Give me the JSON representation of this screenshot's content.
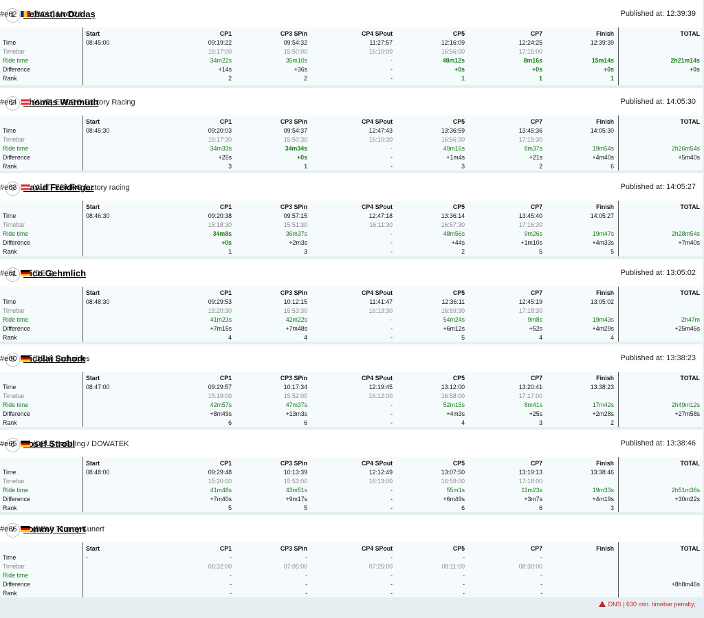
{
  "labels": {
    "time": "Time",
    "timebar": "Timebar",
    "ride_time": "Ride time",
    "difference": "Difference",
    "rank": "Rank",
    "published_prefix": "Published at:"
  },
  "columns": [
    "Start",
    "CP1",
    "CP3 SPin",
    "CP4 SPout",
    "CP5",
    "CP7",
    "Finish",
    "TOTAL"
  ],
  "riders": [
    {
      "pos": "1",
      "name": "Sebastian Dudaș",
      "bib": "#e62",
      "country": "(ROU) Moto24",
      "flag": "ROU",
      "published": "12:39:39",
      "start": "08:45:00",
      "time": [
        "09:19:22",
        "09:54:32",
        "11:27:57",
        "12:16:09",
        "12:24:25",
        "12:39:39",
        ""
      ],
      "timebar": [
        "15:17:00",
        "15:50:00",
        "16:10:00",
        "16:56:00",
        "17:15:00",
        "",
        ""
      ],
      "ride": [
        "34m22s",
        "35m10s",
        "-",
        "48m12s",
        "8m16s",
        "15m14s",
        "2h21m14s"
      ],
      "diff": [
        "+14s",
        "+36s",
        "-",
        "+0s",
        "+0s",
        "+0s",
        "+0s"
      ],
      "rank": [
        "2",
        "2",
        "-",
        "1",
        "1",
        "1",
        ""
      ],
      "best": [
        false,
        false,
        false,
        true,
        true,
        true,
        true
      ],
      "note": ""
    },
    {
      "pos": "2",
      "name": "Thomas Warmuth",
      "bib": "#e64",
      "country": "(AUT) EDURO Factory Racing",
      "flag": "AUT",
      "published": "14:05:30",
      "start": "08:45:30",
      "time": [
        "09:20:03",
        "09:54:37",
        "12:47:43",
        "13:36:59",
        "13:45:36",
        "14:05:30",
        ""
      ],
      "timebar": [
        "15:17:30",
        "15:50:30",
        "16:10:30",
        "16:56:30",
        "17:15:30",
        "",
        ""
      ],
      "ride": [
        "34m33s",
        "34m34s",
        "-",
        "49m16s",
        "8m37s",
        "19m54s",
        "2h26m54s"
      ],
      "diff": [
        "+25s",
        "+0s",
        "-",
        "+1m4s",
        "+21s",
        "+4m40s",
        "+5m40s"
      ],
      "rank": [
        "3",
        "1",
        "-",
        "3",
        "2",
        "6",
        ""
      ],
      "best": [
        false,
        true,
        false,
        false,
        false,
        false,
        false
      ],
      "note": ""
    },
    {
      "pos": "3",
      "name": "David Freidinger",
      "bib": "#e63",
      "country": "(AUT) EDURO factory racing",
      "flag": "AUT",
      "published": "14:05:27",
      "start": "08:46:30",
      "time": [
        "09:20:38",
        "09:57:15",
        "12:47:18",
        "13:36:14",
        "13:45:40",
        "14:05:27",
        ""
      ],
      "timebar": [
        "15:18:30",
        "15:51:30",
        "16:11:30",
        "16:57:30",
        "17:16:30",
        "",
        ""
      ],
      "ride": [
        "34m8s",
        "36m37s",
        "-",
        "48m56s",
        "9m26s",
        "19m47s",
        "2h28m54s"
      ],
      "diff": [
        "+0s",
        "+2m3s",
        "-",
        "+44s",
        "+1m10s",
        "+4m33s",
        "+7m40s"
      ],
      "rank": [
        "1",
        "3",
        "-",
        "2",
        "5",
        "5",
        ""
      ],
      "best": [
        true,
        false,
        false,
        false,
        false,
        false,
        false
      ],
      "note": ""
    },
    {
      "pos": "4",
      "name": "Rico Gehmlich",
      "bib": "#e61",
      "country": "(DEU)",
      "flag": "DEU",
      "published": "13:05:02",
      "start": "08:48:30",
      "time": [
        "09:29:53",
        "10:12:15",
        "11:41:47",
        "12:36:11",
        "12:45:19",
        "13:05:02",
        ""
      ],
      "timebar": [
        "15:20:30",
        "15:53:30",
        "16:13:30",
        "16:59:30",
        "17:18:30",
        "",
        ""
      ],
      "ride": [
        "41m23s",
        "42m22s",
        "-",
        "54m24s",
        "9m8s",
        "19m43s",
        "2h47m"
      ],
      "diff": [
        "+7m15s",
        "+7m48s",
        "-",
        "+6m12s",
        "+52s",
        "+4m29s",
        "+25m46s"
      ],
      "rank": [
        "4",
        "4",
        "-",
        "5",
        "4",
        "4",
        ""
      ],
      "best": [
        false,
        false,
        false,
        false,
        false,
        false,
        false
      ],
      "note": ""
    },
    {
      "pos": "5",
      "name": "Nicolai Schork",
      "bib": "#e60",
      "country": "(DEU) Endurides",
      "flag": "DEU",
      "published": "13:38:23",
      "start": "08:47:00",
      "time": [
        "09:29:57",
        "10:17:34",
        "12:19:45",
        "13:12:00",
        "13:20:41",
        "13:38:23",
        ""
      ],
      "timebar": [
        "15:19:00",
        "15:52:00",
        "16:12:00",
        "16:58:00",
        "17:17:00",
        "",
        ""
      ],
      "ride": [
        "42m57s",
        "47m37s",
        "-",
        "52m15s",
        "8m41s",
        "17m42s",
        "2h49m12s"
      ],
      "diff": [
        "+8m49s",
        "+13m3s",
        "-",
        "+4m3s",
        "+25s",
        "+2m28s",
        "+27m58s"
      ],
      "rank": [
        "6",
        "6",
        "-",
        "4",
        "3",
        "2",
        ""
      ],
      "best": [
        false,
        false,
        false,
        false,
        false,
        false,
        false
      ],
      "note": ""
    },
    {
      "pos": "6",
      "name": "Josef Strobl",
      "bib": "#e65",
      "country": "(DEU) BaSt-Ing / DOWATEK",
      "flag": "DEU",
      "published": "13:38:46",
      "start": "08:48:00",
      "time": [
        "09:29:48",
        "10:13:39",
        "12:12:49",
        "13:07:50",
        "13:19:13",
        "13:38:46",
        ""
      ],
      "timebar": [
        "15:20:00",
        "15:53:00",
        "16:13:00",
        "16:59:00",
        "17:18:00",
        "",
        ""
      ],
      "ride": [
        "41m48s",
        "43m51s",
        "-",
        "55m1s",
        "11m23s",
        "19m33s",
        "2h51m36s"
      ],
      "diff": [
        "+7m40s",
        "+9m17s",
        "-",
        "+6m49s",
        "+3m7s",
        "+4m19s",
        "+30m22s"
      ],
      "rank": [
        "5",
        "5",
        "-",
        "6",
        "6",
        "3",
        ""
      ],
      "best": [
        false,
        false,
        false,
        false,
        false,
        false,
        false
      ],
      "note": ""
    },
    {
      "pos": "7",
      "name": "Tommy Kunert",
      "bib": "#e66",
      "country": "(DEU) Tommy Kunert",
      "flag": "DEU",
      "published": "",
      "start": "-",
      "time": [
        "-",
        "-",
        "-",
        "-",
        "-",
        "",
        ""
      ],
      "timebar": [
        "06:32:00",
        "07:05:00",
        "07:25:00",
        "08:11:00",
        "08:30:00",
        "",
        ""
      ],
      "ride": [
        "-",
        "-",
        "-",
        "-",
        "-",
        "",
        ""
      ],
      "diff": [
        "-",
        "-",
        "-",
        "-",
        "-",
        "",
        "+8h8m46s"
      ],
      "rank": [
        "-",
        "-",
        "-",
        "-",
        "-",
        "",
        ""
      ],
      "best": [
        false,
        false,
        false,
        false,
        false,
        false,
        false
      ],
      "note": "DNS | 630 min. timebar penalty;"
    }
  ]
}
